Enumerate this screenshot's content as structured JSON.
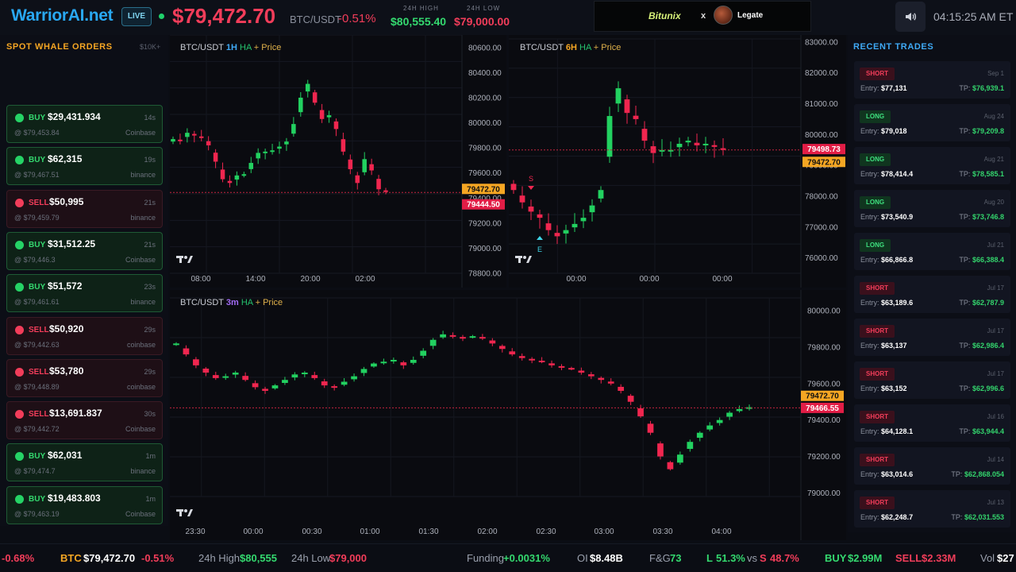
{
  "header": {
    "logo": "WarriorAI.net",
    "live_badge": "LIVE",
    "price": "$79,472.70",
    "pair": "BTC/USDT",
    "change": "-0.51%",
    "high_label": "24H HIGH",
    "high_value": "$80,555.40",
    "low_label": "24H LOW",
    "low_value": "$79,000.00",
    "banner_brand": "Bitunix",
    "banner_x": "x",
    "banner_partner": "Legate",
    "clock": "04:15:25 AM ET",
    "sound_icon": "speaker-icon"
  },
  "whale": {
    "title": "SPOT WHALE ORDERS",
    "filter": "$10K+",
    "orders": [
      {
        "side": "BUY",
        "amount": "$29,431.934",
        "time": "14s",
        "price": "@ $79,453.84",
        "exchange": "Coinbase"
      },
      {
        "side": "BUY",
        "amount": "$62,315",
        "time": "19s",
        "price": "@ $79,467.51",
        "exchange": "binance"
      },
      {
        "side": "SELL",
        "amount": "$50,995",
        "time": "21s",
        "price": "@ $79,459.79",
        "exchange": "binance"
      },
      {
        "side": "BUY",
        "amount": "$31,512.25",
        "time": "21s",
        "price": "@ $79,446.3",
        "exchange": "Coinbase"
      },
      {
        "side": "BUY",
        "amount": "$51,572",
        "time": "23s",
        "price": "@ $79,461.61",
        "exchange": "binance"
      },
      {
        "side": "SELL",
        "amount": "$50,920",
        "time": "29s",
        "price": "@ $79,442.63",
        "exchange": "coinbase"
      },
      {
        "side": "SELL",
        "amount": "$53,780",
        "time": "29s",
        "price": "@ $79,448.89",
        "exchange": "coinbase"
      },
      {
        "side": "SELL",
        "amount": "$13,691.837",
        "time": "30s",
        "price": "@ $79,442.72",
        "exchange": "Coinbase"
      },
      {
        "side": "BUY",
        "amount": "$62,031",
        "time": "1m",
        "price": "@ $79,474.7",
        "exchange": "binance"
      },
      {
        "side": "BUY",
        "amount": "$19,483.803",
        "time": "1m",
        "price": "@ $79,463.19",
        "exchange": "Coinbase"
      }
    ]
  },
  "charts": {
    "c1": {
      "symbol": "BTC/USDT",
      "tf": "1H",
      "ha": "HA",
      "plus": "+",
      "price": "Price",
      "yticks": [
        "80600.00",
        "80400.00",
        "80200.00",
        "80000.00",
        "79800.00",
        "79600.00",
        "79400.00",
        "79200.00",
        "79000.00",
        "78800.00"
      ],
      "xticks": [
        "08:00",
        "14:00",
        "20:00",
        "02:00"
      ],
      "tag_current": "79472.70",
      "tag_line": "79444.50"
    },
    "c2": {
      "symbol": "BTC/USDT",
      "tf": "6H",
      "ha": "HA",
      "plus": "+",
      "price": "Price",
      "yticks": [
        "83000.00",
        "82000.00",
        "81000.00",
        "80000.00",
        "79000.00",
        "78000.00",
        "77000.00",
        "76000.00"
      ],
      "xticks": [
        "00:00",
        "00:00",
        "00:00"
      ],
      "tag_line": "79498.73",
      "tag_current": "79472.70",
      "marker_s": "S",
      "marker_e": "E"
    },
    "c3": {
      "symbol": "BTC/USDT",
      "tf": "3m",
      "ha": "HA",
      "plus": "+",
      "price": "Price",
      "yticks": [
        "80000.00",
        "79800.00",
        "79600.00",
        "79400.00",
        "79200.00",
        "79000.00"
      ],
      "xticks": [
        "23:30",
        "00:00",
        "00:30",
        "01:00",
        "01:30",
        "02:00",
        "02:30",
        "03:00",
        "03:30",
        "04:00"
      ],
      "tag_current": "79472.70",
      "tag_line": "79466.55"
    }
  },
  "chart_data": [
    {
      "type": "candlestick",
      "title": "BTC/USDT 1H HA + Price",
      "x": [
        "08:00",
        "14:00",
        "20:00",
        "02:00"
      ],
      "ylim": [
        78800,
        80700
      ],
      "close": [
        79870,
        79860,
        79920,
        79900,
        79880,
        79820,
        79690,
        79550,
        79520,
        79580,
        79590,
        79680,
        79760,
        79770,
        79780,
        79810,
        79850,
        79990,
        80200,
        80310,
        80160,
        80030,
        80060,
        79950,
        79770,
        79630,
        79520,
        79710,
        79620,
        79470,
        79450
      ]
    },
    {
      "type": "candlestick",
      "title": "BTC/USDT 6H HA + Price",
      "x": [
        "00:00",
        "00:00",
        "00:00"
      ],
      "ylim": [
        75500,
        83100
      ],
      "close": [
        78200,
        77800,
        77500,
        77300,
        76900,
        76700,
        76900,
        77100,
        77300,
        77700,
        78200,
        80600,
        81500,
        80700,
        80500,
        79800,
        79400,
        79500,
        79500,
        79700,
        79800,
        79650,
        79700,
        79600,
        79500
      ]
    },
    {
      "type": "candlestick",
      "title": "BTC/USDT 3m HA + Price",
      "x": [
        "23:30",
        "00:00",
        "00:30",
        "01:00",
        "01:30",
        "02:00",
        "02:30",
        "03:00",
        "03:30",
        "04:00"
      ],
      "ylim": [
        78980,
        80070
      ],
      "close": [
        79820,
        79760,
        79700,
        79660,
        79630,
        79640,
        79660,
        79620,
        79580,
        79560,
        79590,
        79620,
        79650,
        79660,
        79630,
        79590,
        79580,
        79610,
        79640,
        79680,
        79710,
        79720,
        79730,
        79700,
        79730,
        79780,
        79840,
        79870,
        79860,
        79850,
        79860,
        79850,
        79820,
        79790,
        79760,
        79740,
        79730,
        79720,
        79700,
        79690,
        79680,
        79660,
        79640,
        79620,
        79600,
        79560,
        79500,
        79420,
        79330,
        79200,
        79130,
        79210,
        79280,
        79330,
        79370,
        79400,
        79440,
        79460,
        79470
      ]
    }
  ],
  "recent": {
    "title": "RECENT TRADES",
    "trades": [
      {
        "side": "SHORT",
        "date": "Sep 1",
        "entry": "$77,131",
        "tp": "$76,939.1"
      },
      {
        "side": "LONG",
        "date": "Aug 24",
        "entry": "$79,018",
        "tp": "$79,209.8"
      },
      {
        "side": "LONG",
        "date": "Aug 21",
        "entry": "$78,414.4",
        "tp": "$78,585.1"
      },
      {
        "side": "LONG",
        "date": "Aug 20",
        "entry": "$73,540.9",
        "tp": "$73,746.8"
      },
      {
        "side": "LONG",
        "date": "Jul 21",
        "entry": "$66,866.8",
        "tp": "$66,388.4"
      },
      {
        "side": "SHORT",
        "date": "Jul 17",
        "entry": "$63,189.6",
        "tp": "$62,787.9"
      },
      {
        "side": "SHORT",
        "date": "Jul 17",
        "entry": "$63,137",
        "tp": "$62,986.4"
      },
      {
        "side": "SHORT",
        "date": "Jul 17",
        "entry": "$63,152",
        "tp": "$62,996.6"
      },
      {
        "side": "SHORT",
        "date": "Jul 16",
        "entry": "$64,128.1",
        "tp": "$63,944.4"
      },
      {
        "side": "SHORT",
        "date": "Jul 14",
        "entry": "$63,014.6",
        "tp": "$62,868.054"
      },
      {
        "side": "SHORT",
        "date": "Jul 13",
        "entry": "$62,248.7",
        "tp": "$62,031.553"
      }
    ],
    "entry_label": "Entry:",
    "tp_label": "TP:"
  },
  "ticker": {
    "lead_change": "-0.68%",
    "btc_label": "BTC",
    "btc_price": "$79,472.70",
    "btc_change": "-0.51%",
    "high_label": "24h High",
    "high_value": "$80,555",
    "low_label": "24h Low",
    "low_value": "$79,000",
    "funding_label": "Funding",
    "funding_value": "+0.0031%",
    "oi_label": "OI",
    "oi_value": "$8.48B",
    "fg_label": "F&G",
    "fg_value": "73",
    "long_label": "L",
    "long_value": "51.3%",
    "vs_label": "vs",
    "short_label": "S",
    "short_value": "48.7%",
    "buy_label": "BUY",
    "buy_value": "$2.99M",
    "sell_label": "SELL",
    "sell_value": "$2.33M",
    "vol_label": "Vol",
    "vol_value": "$27"
  }
}
